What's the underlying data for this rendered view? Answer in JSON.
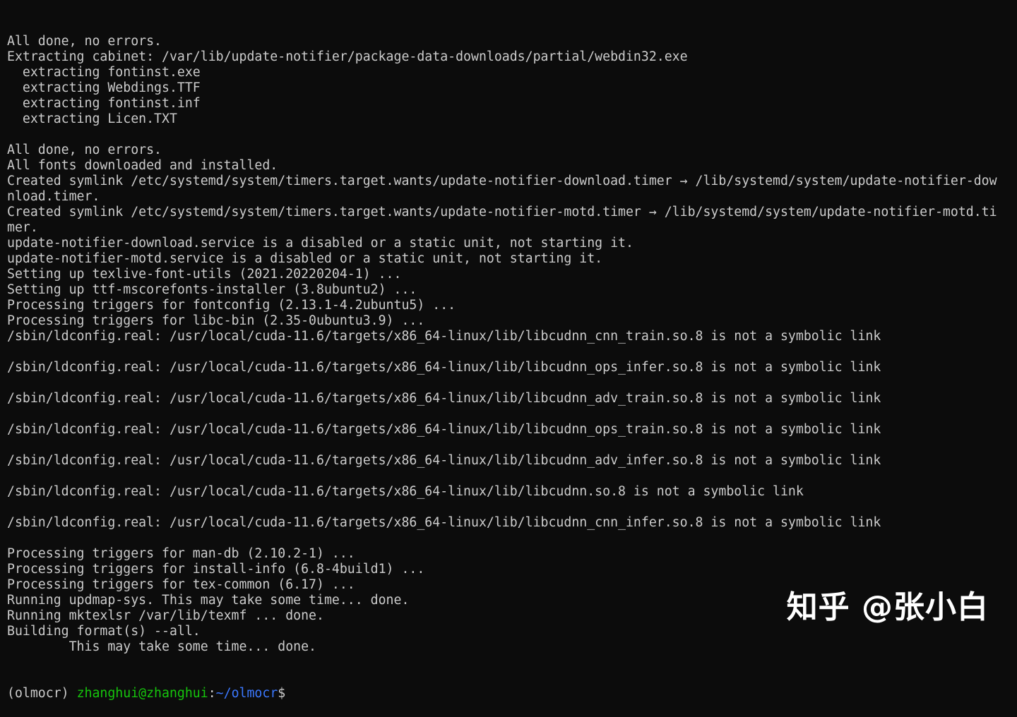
{
  "terminal": {
    "lines": [
      "All done, no errors.",
      "Extracting cabinet: /var/lib/update-notifier/package-data-downloads/partial/webdin32.exe",
      "  extracting fontinst.exe",
      "  extracting Webdings.TTF",
      "  extracting fontinst.inf",
      "  extracting Licen.TXT",
      "",
      "All done, no errors.",
      "All fonts downloaded and installed.",
      "Created symlink /etc/systemd/system/timers.target.wants/update-notifier-download.timer → /lib/systemd/system/update-notifier-dow",
      "nload.timer.",
      "Created symlink /etc/systemd/system/timers.target.wants/update-notifier-motd.timer → /lib/systemd/system/update-notifier-motd.ti",
      "mer.",
      "update-notifier-download.service is a disabled or a static unit, not starting it.",
      "update-notifier-motd.service is a disabled or a static unit, not starting it.",
      "Setting up texlive-font-utils (2021.20220204-1) ...",
      "Setting up ttf-mscorefonts-installer (3.8ubuntu2) ...",
      "Processing triggers for fontconfig (2.13.1-4.2ubuntu5) ...",
      "Processing triggers for libc-bin (2.35-0ubuntu3.9) ...",
      "/sbin/ldconfig.real: /usr/local/cuda-11.6/targets/x86_64-linux/lib/libcudnn_cnn_train.so.8 is not a symbolic link",
      "",
      "/sbin/ldconfig.real: /usr/local/cuda-11.6/targets/x86_64-linux/lib/libcudnn_ops_infer.so.8 is not a symbolic link",
      "",
      "/sbin/ldconfig.real: /usr/local/cuda-11.6/targets/x86_64-linux/lib/libcudnn_adv_train.so.8 is not a symbolic link",
      "",
      "/sbin/ldconfig.real: /usr/local/cuda-11.6/targets/x86_64-linux/lib/libcudnn_ops_train.so.8 is not a symbolic link",
      "",
      "/sbin/ldconfig.real: /usr/local/cuda-11.6/targets/x86_64-linux/lib/libcudnn_adv_infer.so.8 is not a symbolic link",
      "",
      "/sbin/ldconfig.real: /usr/local/cuda-11.6/targets/x86_64-linux/lib/libcudnn.so.8 is not a symbolic link",
      "",
      "/sbin/ldconfig.real: /usr/local/cuda-11.6/targets/x86_64-linux/lib/libcudnn_cnn_infer.so.8 is not a symbolic link",
      "",
      "Processing triggers for man-db (2.10.2-1) ...",
      "Processing triggers for install-info (6.8-4build1) ...",
      "Processing triggers for tex-common (6.17) ...",
      "Running updmap-sys. This may take some time... done.",
      "Running mktexlsr /var/lib/texmf ... done.",
      "Building format(s) --all.",
      "        This may take some time... done."
    ],
    "prompt": {
      "env": "(olmocr)",
      "user_host": "zhanghui@zhanghui",
      "colon": ":",
      "path": "~/olmocr",
      "symbol": "$"
    }
  },
  "watermark": {
    "text": "知乎 @张小白"
  },
  "colors": {
    "background": "#0c0c0c",
    "foreground": "#cccccc",
    "user_host": "#16c60c",
    "path": "#3b78ff",
    "watermark": "#ffffff"
  }
}
